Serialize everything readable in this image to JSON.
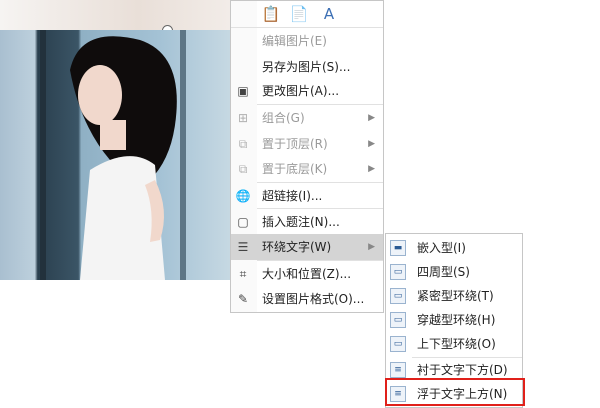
{
  "paste_options": [
    "paste-keep-format-icon",
    "paste-merge-icon",
    "paste-text-only-icon"
  ],
  "menu": {
    "items": [
      {
        "label": "编辑图片(E)",
        "icon": "",
        "disabled": true,
        "arrow": false
      },
      {
        "label": "另存为图片(S)...",
        "icon": "",
        "disabled": false,
        "arrow": false
      },
      {
        "label": "更改图片(A)...",
        "icon": "change-picture-icon",
        "disabled": false,
        "arrow": false
      },
      {
        "label": "组合(G)",
        "icon": "group-icon",
        "disabled": true,
        "arrow": true
      },
      {
        "label": "置于顶层(R)",
        "icon": "bring-to-front-icon",
        "disabled": true,
        "arrow": true
      },
      {
        "label": "置于底层(K)",
        "icon": "send-to-back-icon",
        "disabled": true,
        "arrow": true
      },
      {
        "label": "超链接(I)...",
        "icon": "hyperlink-icon",
        "disabled": false,
        "arrow": false
      },
      {
        "label": "插入题注(N)...",
        "icon": "insert-caption-icon",
        "disabled": false,
        "arrow": false
      },
      {
        "label": "环绕文字(W)",
        "icon": "wrap-text-icon",
        "disabled": false,
        "arrow": true
      },
      {
        "label": "大小和位置(Z)...",
        "icon": "size-position-icon",
        "disabled": false,
        "arrow": false
      },
      {
        "label": "设置图片格式(O)...",
        "icon": "format-picture-icon",
        "disabled": false,
        "arrow": false
      }
    ]
  },
  "submenu": {
    "items": [
      {
        "label": "嵌入型(I)",
        "icon": "inline-wrap-icon"
      },
      {
        "label": "四周型(S)",
        "icon": "square-wrap-icon"
      },
      {
        "label": "紧密型环绕(T)",
        "icon": "tight-wrap-icon"
      },
      {
        "label": "穿越型环绕(H)",
        "icon": "through-wrap-icon"
      },
      {
        "label": "上下型环绕(O)",
        "icon": "top-bottom-wrap-icon"
      },
      {
        "label": "衬于文字下方(D)",
        "icon": "behind-text-icon"
      },
      {
        "label": "浮于文字上方(N)",
        "icon": "in-front-of-text-icon"
      }
    ]
  }
}
